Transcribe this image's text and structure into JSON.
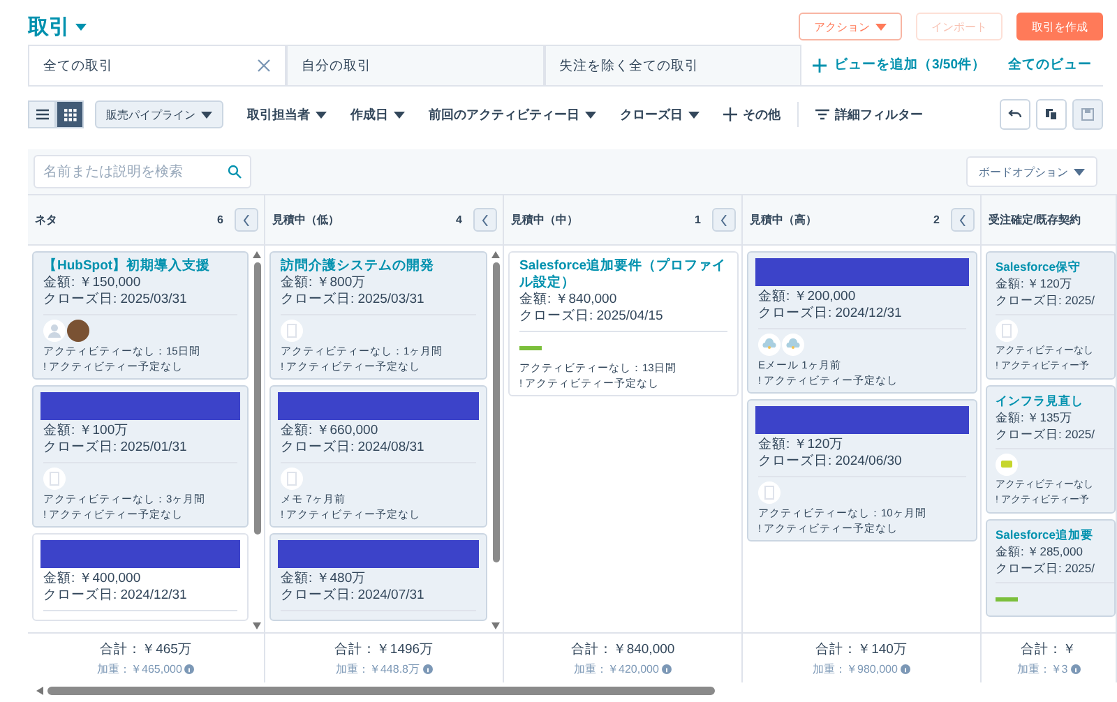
{
  "header": {
    "title": "取引",
    "buttons": [
      {
        "label": "アクション",
        "kind": "outline",
        "caret": true,
        "disabled": false
      },
      {
        "label": "インポート",
        "kind": "outline",
        "caret": false,
        "disabled": true
      },
      {
        "label": "取引を作成",
        "kind": "primary",
        "caret": false,
        "disabled": false
      }
    ]
  },
  "tabs": [
    {
      "label": "全ての取引",
      "selected": true
    },
    {
      "label": "自分の取引",
      "selected": false
    },
    {
      "label": "失注を除く全ての取引",
      "selected": false
    }
  ],
  "add_view": "ビューを追加（3/50件）",
  "all_views": "全てのビュー",
  "view_toggle": [
    {
      "kind": "list",
      "selected": false
    },
    {
      "kind": "grid",
      "selected": true
    }
  ],
  "pipeline": "販売パイプライン",
  "filters": [
    "取引担当者",
    "作成日",
    "前回のアクティビティー日",
    "クローズ日"
  ],
  "more_filters": "その他",
  "advanced_filter": "詳細フィルター",
  "search": {
    "placeholder": "名前または説明を検索"
  },
  "board_options": "ボードオプション",
  "columns": [
    {
      "name": "ネタ",
      "count": "6",
      "scrollable": true,
      "cards": [
        {
          "kind": "titled",
          "title": "【HubSpot】初期導入支援",
          "highlighted": true,
          "amount": "金額: ￥150,000",
          "close_date": "クローズ日: 2025/03/31",
          "avatars": [
            {
              "kind": "person"
            },
            {
              "kind": "photo"
            }
          ],
          "activity": "アクティビティーなし：15日間",
          "next": "! アクティビティー予定なし"
        },
        {
          "kind": "redacted",
          "highlighted": true,
          "amount": "金額: ￥100万",
          "close_date": "クローズ日: 2025/01/31",
          "avatars": [
            {
              "kind": "document"
            }
          ],
          "activity": "アクティビティーなし：3ヶ月間",
          "next": "! アクティビティー予定なし"
        },
        {
          "kind": "redacted",
          "highlighted": false,
          "amount": "金額: ￥400,000",
          "close_date": "クローズ日: 2024/12/31"
        }
      ],
      "total": "合計：￥465万",
      "weighted": "加重：￥465,000"
    },
    {
      "name": "見積中（低）",
      "count": "4",
      "scrollable": true,
      "cards": [
        {
          "kind": "titled",
          "title": "訪問介護システムの開発",
          "highlighted": true,
          "amount": "金額: ￥800万",
          "close_date": "クローズ日: 2025/03/31",
          "avatars": [
            {
              "kind": "document"
            }
          ],
          "activity": "アクティビティーなし：1ヶ月間",
          "next": "! アクティビティー予定なし"
        },
        {
          "kind": "redacted",
          "highlighted": true,
          "amount": "金額: ￥660,000",
          "close_date": "クローズ日: 2024/08/31",
          "avatars": [
            {
              "kind": "document"
            }
          ],
          "activity": "メモ 7ヶ月前",
          "next": "! アクティビティー予定なし"
        },
        {
          "kind": "redacted",
          "highlighted": true,
          "amount": "金額: ￥480万",
          "close_date": "クローズ日: 2024/07/31"
        }
      ],
      "total": "合計：￥1496万",
      "weighted": "加重：￥448.8万"
    },
    {
      "name": "見積中（中）",
      "count": "1",
      "cards": [
        {
          "kind": "titled",
          "title": "Salesforce追加要件（プロファイル設定）",
          "highlighted": false,
          "amount": "金額: ￥840,000",
          "close_date": "クローズ日: 2025/04/15",
          "avatars": [
            {
              "kind": "bar"
            }
          ],
          "activity": "アクティビティーなし：13日間",
          "next": "! アクティビティー予定なし"
        }
      ],
      "total": "合計：￥840,000",
      "weighted": "加重：￥420,000"
    },
    {
      "name": "見積中（高）",
      "count": "2",
      "cards": [
        {
          "kind": "redacted",
          "highlighted": true,
          "amount": "金額: ￥200,000",
          "close_date": "クローズ日: 2024/12/31",
          "avatars": [
            {
              "kind": "cloud"
            },
            {
              "kind": "cloud"
            }
          ],
          "activity": "Eメール 1ヶ月前",
          "next": "! アクティビティー予定なし"
        },
        {
          "kind": "redacted",
          "highlighted": true,
          "amount": "金額: ￥120万",
          "close_date": "クローズ日: 2024/06/30",
          "avatars": [
            {
              "kind": "document"
            }
          ],
          "activity": "アクティビティーなし：10ヶ月間",
          "next": "! アクティビティー予定なし"
        }
      ],
      "total": "合計：￥140万",
      "weighted": "加重：￥980,000"
    },
    {
      "name": "受注確定/既存契約",
      "cards": [
        {
          "kind": "titled",
          "title": "Salesforce保守",
          "highlighted": true,
          "amount": "金額: ￥120万",
          "close_date": "クローズ日: 2025/",
          "avatars": [
            {
              "kind": "document"
            }
          ],
          "activity": "アクティビティーなし",
          "next": "! アクティビティー予"
        },
        {
          "kind": "titled",
          "title": "インフラ見直し",
          "highlighted": true,
          "amount": "金額: ￥135万",
          "close_date": "クローズ日: 2025/",
          "avatars": [
            {
              "kind": "logo"
            }
          ],
          "activity": "アクティビティーなし",
          "next": "! アクティビティー予"
        },
        {
          "kind": "titled",
          "title": "Salesforce追加要",
          "highlighted": true,
          "amount": "金額: ￥285,000",
          "close_date": "クローズ日: 2025/",
          "avatars": [
            {
              "kind": "bar"
            }
          ]
        }
      ],
      "total": "合計：￥",
      "weighted": "加重：￥3"
    }
  ]
}
